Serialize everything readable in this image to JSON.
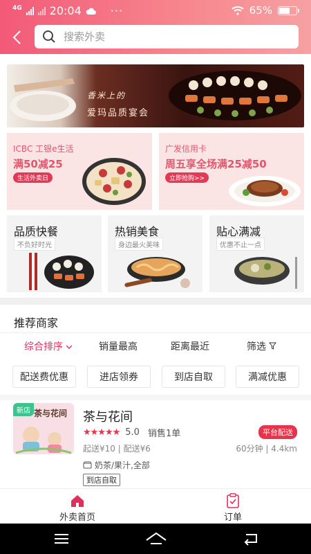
{
  "status_bar": {
    "network": "4G",
    "time": "20:04",
    "dots": "···",
    "battery_pct": "65%",
    "battery_level": 0.65
  },
  "header": {
    "search_placeholder": "搜索外卖"
  },
  "banner": {
    "line1": "香米上的",
    "line2": "爱玛品质宴会"
  },
  "promos": [
    {
      "line1": "ICBC 工银e生活",
      "line2": "满50减25",
      "tag": "生活外卖日"
    },
    {
      "line1": "广发信用卡",
      "line2": "周五享全场满25减50",
      "tag": "立即抢购>>"
    }
  ],
  "categories": [
    {
      "title": "品质快餐",
      "subtitle": "不负好时光"
    },
    {
      "title": "热销美食",
      "subtitle": "身边最火美味"
    },
    {
      "title": "贴心满减",
      "subtitle": "优惠不止一点"
    }
  ],
  "section_title": "推荐商家",
  "sorts": [
    "综合排序",
    "销量最高",
    "距离最近",
    "筛选"
  ],
  "chips": [
    "配送费优惠",
    "进店领券",
    "到店自取",
    "满减优惠"
  ],
  "shop": {
    "badge": "新店",
    "logo_text": "茶与花间",
    "name": "茶与花间",
    "stars": "★★★★★",
    "score": "5.0",
    "sales": "销售1单",
    "platform_tag": "平台配送",
    "fees": "起送¥10 | 配送¥6",
    "eta": "60分钟 | 4.4km",
    "cuisine": "奶茶/果汁,全部",
    "pickup": "到店自取"
  },
  "tabs": [
    {
      "label": "外卖首页"
    },
    {
      "label": "订单"
    }
  ],
  "colors": {
    "accent": "#e8334a",
    "header_gradient_start": "#f25a78",
    "header_gradient_end": "#f6a1a3",
    "active_sort": "#e03060"
  }
}
